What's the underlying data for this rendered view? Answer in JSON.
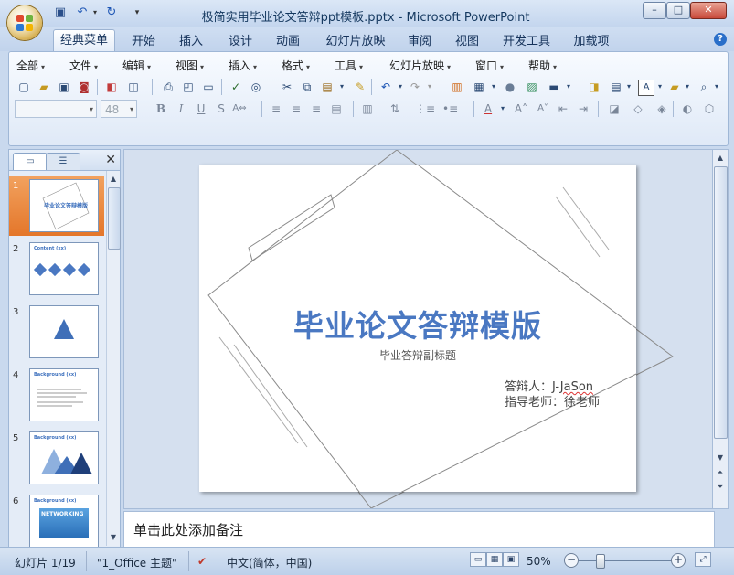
{
  "window": {
    "title": "极简实用毕业论文答辩ppt模板.pptx - Microsoft PowerPoint",
    "controls": [
      "–",
      "□",
      "✕"
    ]
  },
  "qat": {
    "icons": [
      "save-icon",
      "undo-icon",
      "redo-icon",
      "customize-icon"
    ]
  },
  "tabs": [
    "经典菜单",
    "开始",
    "插入",
    "设计",
    "动画",
    "幻灯片放映",
    "审阅",
    "视图",
    "开发工具",
    "加载项"
  ],
  "active_tab": "经典菜单",
  "menus": [
    "全部",
    "文件",
    "编辑",
    "视图",
    "插入",
    "格式",
    "工具",
    "幻灯片放映",
    "窗口",
    "帮助"
  ],
  "font": {
    "name_value": "",
    "size_value": "48"
  },
  "format_buttons": {
    "bold": "B",
    "italic": "I",
    "underline": "U",
    "shadow": "S",
    "font_color": "A"
  },
  "panel": {
    "close": "✕"
  },
  "thumbnails": [
    {
      "num": "1",
      "title": "毕业论文答辩模版",
      "selected": true
    },
    {
      "num": "2",
      "title": "Content (xx)"
    },
    {
      "num": "3",
      "title": ""
    },
    {
      "num": "4",
      "title": "Background (xx)"
    },
    {
      "num": "5",
      "title": "Background (xx)"
    },
    {
      "num": "6",
      "title": "Background (xx)",
      "banner": "NETWORKING"
    }
  ],
  "slide": {
    "title": "毕业论文答辩模版",
    "subtitle": "毕业答辩副标题",
    "defender_prefix": "答辩人：J-",
    "defender_name": "JaSon",
    "advisor": "指导老师：徐老师"
  },
  "notes": {
    "placeholder": "单击此处添加备注"
  },
  "status": {
    "slide_info": "幻灯片 1/19",
    "theme": "\"1_Office 主题\"",
    "language": "中文(简体，中国)",
    "zoom": "50%",
    "zoom_minus": "−",
    "zoom_plus": "+"
  },
  "colors": {
    "accent": "#4a78c2",
    "selected_thumb": "#e4762a",
    "ribbon_bg": "#dfe9f7"
  }
}
